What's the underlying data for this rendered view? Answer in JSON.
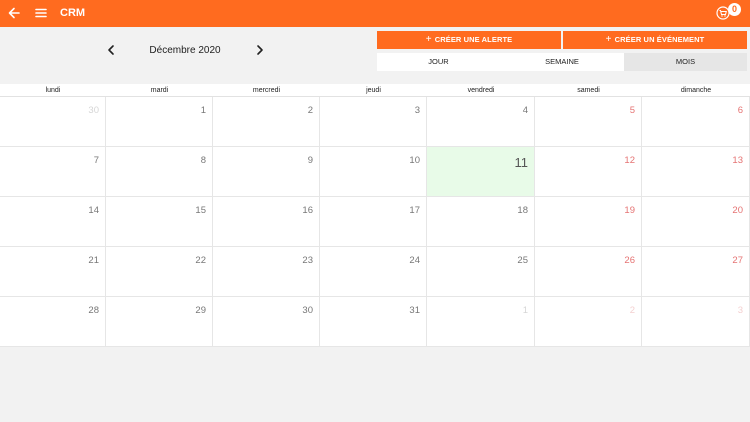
{
  "header": {
    "title": "CRM",
    "cart_count": "0",
    "accent_color": "#ff6b1f",
    "icons": [
      "arrow-left-icon",
      "hamburger-menu-icon",
      "cart-icon"
    ]
  },
  "toolbar": {
    "month_label": "Décembre 2020",
    "create_alert_label": "CRÉER UNE ALERTE",
    "create_event_label": "CRÉER UN ÉVÉNEMENT",
    "tabs": [
      {
        "label": "JOUR",
        "selected": false
      },
      {
        "label": "SEMAINE",
        "selected": false
      },
      {
        "label": "MOIS",
        "selected": true
      }
    ]
  },
  "calendar": {
    "day_headers": [
      "lundi",
      "mardi",
      "mercredi",
      "jeudi",
      "vendredi",
      "samedi",
      "dimanche"
    ],
    "today": "11",
    "today_color": "#e8fbe8",
    "weekend_color": "#e57373",
    "weeks": [
      [
        {
          "n": "30",
          "muted": true
        },
        {
          "n": "1"
        },
        {
          "n": "2"
        },
        {
          "n": "3"
        },
        {
          "n": "4"
        },
        {
          "n": "5",
          "weekend": true
        },
        {
          "n": "6",
          "weekend": true
        }
      ],
      [
        {
          "n": "7"
        },
        {
          "n": "8"
        },
        {
          "n": "9"
        },
        {
          "n": "10"
        },
        {
          "n": "11",
          "today": true
        },
        {
          "n": "12",
          "weekend": true
        },
        {
          "n": "13",
          "weekend": true
        }
      ],
      [
        {
          "n": "14"
        },
        {
          "n": "15"
        },
        {
          "n": "16"
        },
        {
          "n": "17"
        },
        {
          "n": "18"
        },
        {
          "n": "19",
          "weekend": true
        },
        {
          "n": "20",
          "weekend": true
        }
      ],
      [
        {
          "n": "21"
        },
        {
          "n": "22"
        },
        {
          "n": "23"
        },
        {
          "n": "24"
        },
        {
          "n": "25"
        },
        {
          "n": "26",
          "weekend": true
        },
        {
          "n": "27",
          "weekend": true
        }
      ],
      [
        {
          "n": "28"
        },
        {
          "n": "29"
        },
        {
          "n": "30"
        },
        {
          "n": "31"
        },
        {
          "n": "1",
          "muted": true
        },
        {
          "n": "2",
          "muted": true,
          "weekend": true
        },
        {
          "n": "3",
          "muted": true,
          "weekend": true
        }
      ]
    ]
  }
}
